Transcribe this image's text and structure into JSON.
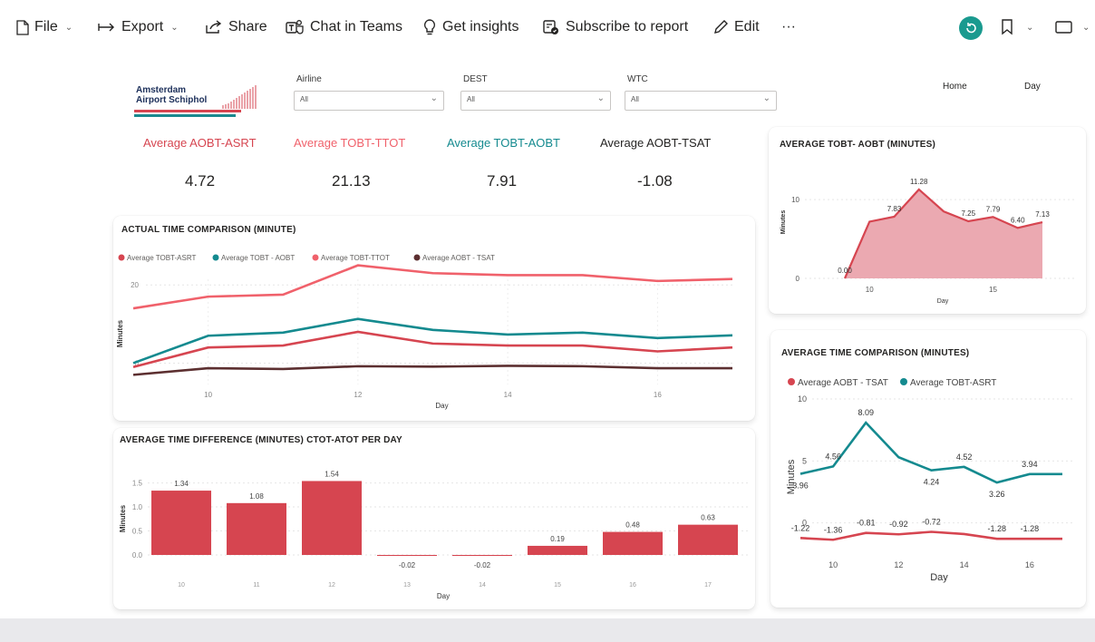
{
  "toolbar": {
    "file_label": "File",
    "export_label": "Export",
    "share_label": "Share",
    "teams_label": "Chat in Teams",
    "insights_label": "Get insights",
    "subscribe_label": "Subscribe to report",
    "edit_label": "Edit",
    "more_label": "···"
  },
  "report": {
    "logo_line1": "Amsterdam",
    "logo_line2": "Airport Schiphol",
    "nav_home": "Home",
    "nav_day": "Day"
  },
  "slicers": [
    {
      "label": "Airline",
      "value": "All"
    },
    {
      "label": "DEST",
      "value": "All"
    },
    {
      "label": "WTC",
      "value": "All"
    }
  ],
  "kpis": [
    {
      "title": "Average AOBT-ASRT",
      "value": "4.72",
      "color": "#d64550"
    },
    {
      "title": "Average TOBT-TTOT",
      "value": "21.13",
      "color": "#f0616b"
    },
    {
      "title": "Average TOBT-AOBT",
      "value": "7.91",
      "color": "#148a8f"
    },
    {
      "title": "Average AOBT-TSAT",
      "value": "-1.08",
      "color": "#252423"
    }
  ],
  "colors": {
    "red": "#d64550",
    "salmon": "#f0616b",
    "teal": "#148a8f",
    "dark": "#5c2f30",
    "area_fill": "#e79aa3",
    "brand_teal": "#1a8a8f"
  },
  "chart_data": [
    {
      "type": "line",
      "title": "ACTUAL TIME COMPARISON (MINUTE)",
      "xlabel": "Day",
      "ylabel": "Minutes",
      "x": [
        9,
        10,
        11,
        12,
        13,
        14,
        15,
        16,
        17
      ],
      "x_ticks": [
        "10",
        "12",
        "14",
        "16"
      ],
      "y_ticks": [
        "0",
        "20"
      ],
      "ylim": [
        -5,
        27
      ],
      "series": [
        {
          "name": "Average TOBT-ASRT",
          "color": "#d64550",
          "values": [
            -1,
            4,
            4.5,
            8,
            5,
            4.5,
            4.5,
            3,
            4
          ]
        },
        {
          "name": "Average TOBT - AOBT",
          "color": "#148a8f",
          "values": [
            0,
            7,
            7.8,
            11.3,
            8.5,
            7.3,
            7.8,
            6.4,
            7.1
          ]
        },
        {
          "name": "Average TOBT-TTOT",
          "color": "#f0616b",
          "values": [
            14,
            17,
            17.5,
            25,
            23,
            22.5,
            22.5,
            21,
            21.5
          ]
        },
        {
          "name": "Average AOBT - TSAT",
          "color": "#5c2f30",
          "values": [
            -3,
            -1.3,
            -1.5,
            -0.8,
            -0.9,
            -0.7,
            -0.8,
            -1.3,
            -1.3
          ]
        }
      ],
      "legend": "top-left"
    },
    {
      "type": "bar",
      "title": "AVERAGE TIME DIFFERENCE (MINUTES) CTOT-ATOT PER DAY",
      "xlabel": "Day",
      "ylabel": "Minutes",
      "categories": [
        "10",
        "11",
        "12",
        "13",
        "14",
        "15",
        "16",
        "17"
      ],
      "values": [
        1.34,
        1.08,
        1.54,
        -0.02,
        -0.02,
        0.19,
        0.48,
        0.63
      ],
      "labels": [
        "1.34",
        "1.08",
        "1.54",
        "-0.02",
        "-0.02",
        "0.19",
        "0.48",
        "0.63"
      ],
      "y_ticks": [
        "0.0",
        "0.5",
        "1.0",
        "1.5"
      ],
      "ylim": [
        0,
        1.7
      ]
    },
    {
      "type": "area",
      "title": "AVERAGE TOBT- AOBT (MINUTES)",
      "xlabel": "Day",
      "ylabel": "Minutes",
      "x": [
        9,
        10,
        11,
        12,
        13,
        14,
        15,
        16,
        17
      ],
      "values": [
        0.0,
        7.2,
        7.83,
        11.28,
        8.5,
        7.25,
        7.79,
        6.4,
        7.13
      ],
      "labels": [
        "0.00",
        "",
        "7.83",
        "11.28",
        "",
        "7.25",
        "7.79",
        "6.40",
        "7.13"
      ],
      "x_ticks": [
        "10",
        "15"
      ],
      "y_ticks": [
        "0",
        "10"
      ],
      "ylim": [
        0,
        13
      ]
    },
    {
      "type": "line",
      "title": "AVERAGE TIME COMPARISON (MINUTES)",
      "xlabel": "Day",
      "ylabel": "Minutes",
      "x": [
        9,
        10,
        11,
        12,
        13,
        14,
        15,
        16,
        17
      ],
      "x_ticks": [
        "10",
        "12",
        "14",
        "16"
      ],
      "y_ticks": [
        "0",
        "5",
        "10"
      ],
      "ylim": [
        -2,
        10
      ],
      "series": [
        {
          "name": "Average AOBT - TSAT",
          "color": "#d64550",
          "values": [
            -1.22,
            -1.36,
            -0.81,
            -0.92,
            -0.72,
            -0.9,
            -1.28,
            -1.28,
            -1.28
          ],
          "labels": [
            "-1.22",
            "-1.36",
            "-0.81",
            "-0.92",
            "-0.72",
            "",
            "-1.28",
            "-1.28",
            ""
          ]
        },
        {
          "name": "Average TOBT-ASRT",
          "color": "#148a8f",
          "values": [
            3.96,
            4.56,
            8.09,
            5.3,
            4.24,
            4.52,
            3.26,
            3.94,
            3.94
          ],
          "labels": [
            "3.96",
            "4.56",
            "8.09",
            "",
            "4.24",
            "4.52",
            "3.26",
            "3.94",
            ""
          ]
        }
      ],
      "legend": "top-left"
    }
  ]
}
